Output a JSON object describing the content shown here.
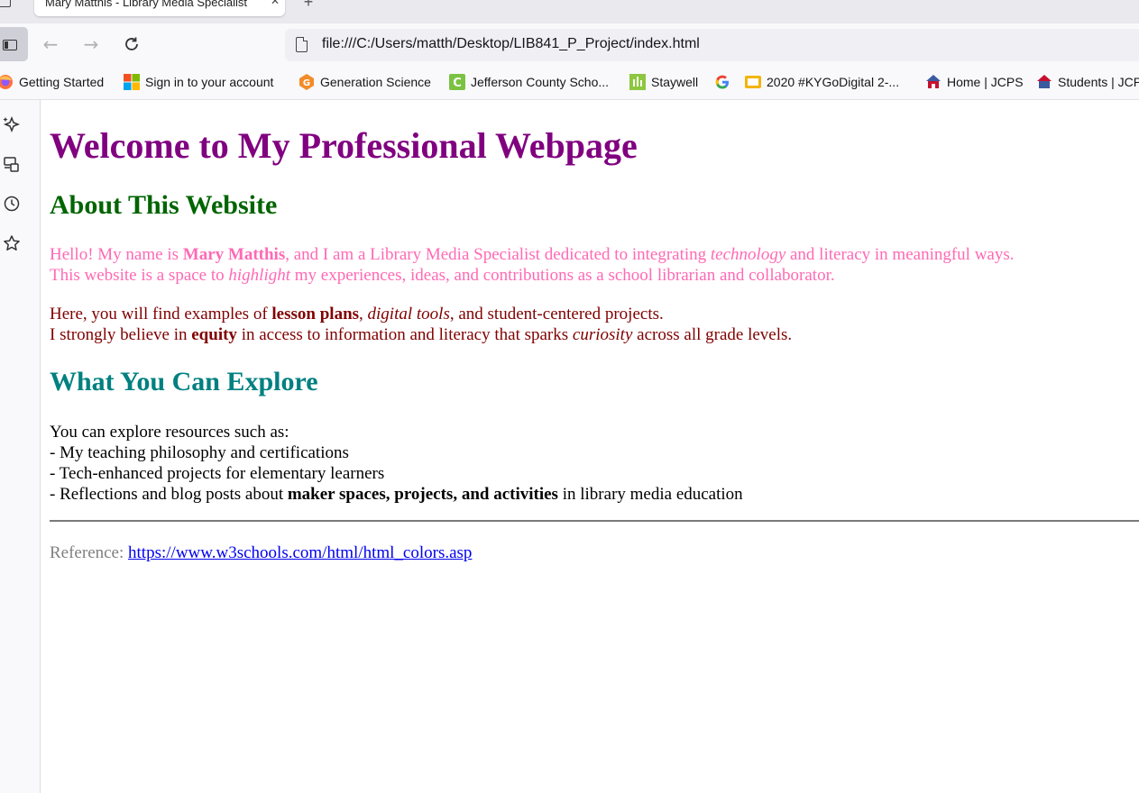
{
  "browser": {
    "tab": {
      "title": "Mary Matthis - Library Media Specialist"
    },
    "url": "file:///C:/Users/matth/Desktop/LIB841_P_Project/index.html",
    "bookmarks": [
      {
        "label": "Getting Started",
        "icon": "firefox-icon"
      },
      {
        "label": "Sign in to your account",
        "icon": "microsoft-icon"
      },
      {
        "label": "Generation Science",
        "icon": "generation-science-icon"
      },
      {
        "label": "Jefferson County Scho...",
        "icon": "jefferson-county-icon"
      },
      {
        "label": "Staywell",
        "icon": "staywell-icon"
      },
      {
        "label": "",
        "icon": "google-icon"
      },
      {
        "label": "2020 #KYGoDigital 2-...",
        "icon": "google-slides-icon"
      },
      {
        "label": "Home | JCPS",
        "icon": "jcps-icon"
      },
      {
        "label": "Students | JCPS",
        "icon": "jcps-students-icon"
      }
    ],
    "colors": {
      "toolbar_bg": "#f9f9fb",
      "tabstrip_bg": "#e9e9ee"
    }
  },
  "page": {
    "title": "Welcome to My Professional Webpage",
    "about": {
      "heading": "About This Website",
      "p1": {
        "a": "Hello! My name is ",
        "name": "Mary Matthis",
        "b": ", and I am a Library Media Specialist dedicated to integrating ",
        "em1": "technology",
        "c": " and literacy in meaningful ways.",
        "d": "This website is a space to ",
        "em2": "highlight",
        "e": " my experiences, ideas, and contributions as a school librarian and collaborator."
      },
      "p2": {
        "a": "Here, you will find examples of ",
        "b1": "lesson plans",
        "b": ", ",
        "em1": "digital tools",
        "c": ", and student-centered projects.",
        "d": "I strongly believe in ",
        "b2": "equity",
        "e": " in access to information and literacy that sparks ",
        "em2": "curiosity",
        "f": " across all grade levels."
      }
    },
    "explore": {
      "heading": "What You Can Explore",
      "intro": "You can explore resources such as:",
      "item1": "- My teaching philosophy and certifications",
      "item2": "- Tech-enhanced projects for elementary learners",
      "item3a": "- Reflections and blog posts about ",
      "item3b": "maker spaces, projects, and activities",
      "item3c": " in library media education"
    },
    "reference": {
      "label": "Reference: ",
      "link": "https://www.w3schools.com/html/html_colors.asp"
    },
    "colors": {
      "title": "#800080",
      "about_heading": "#006400",
      "pink_text": "#ff69b4",
      "maroon_text": "#800000",
      "explore_heading": "#008080",
      "reference_label": "#808080",
      "link": "#0000ee"
    }
  }
}
